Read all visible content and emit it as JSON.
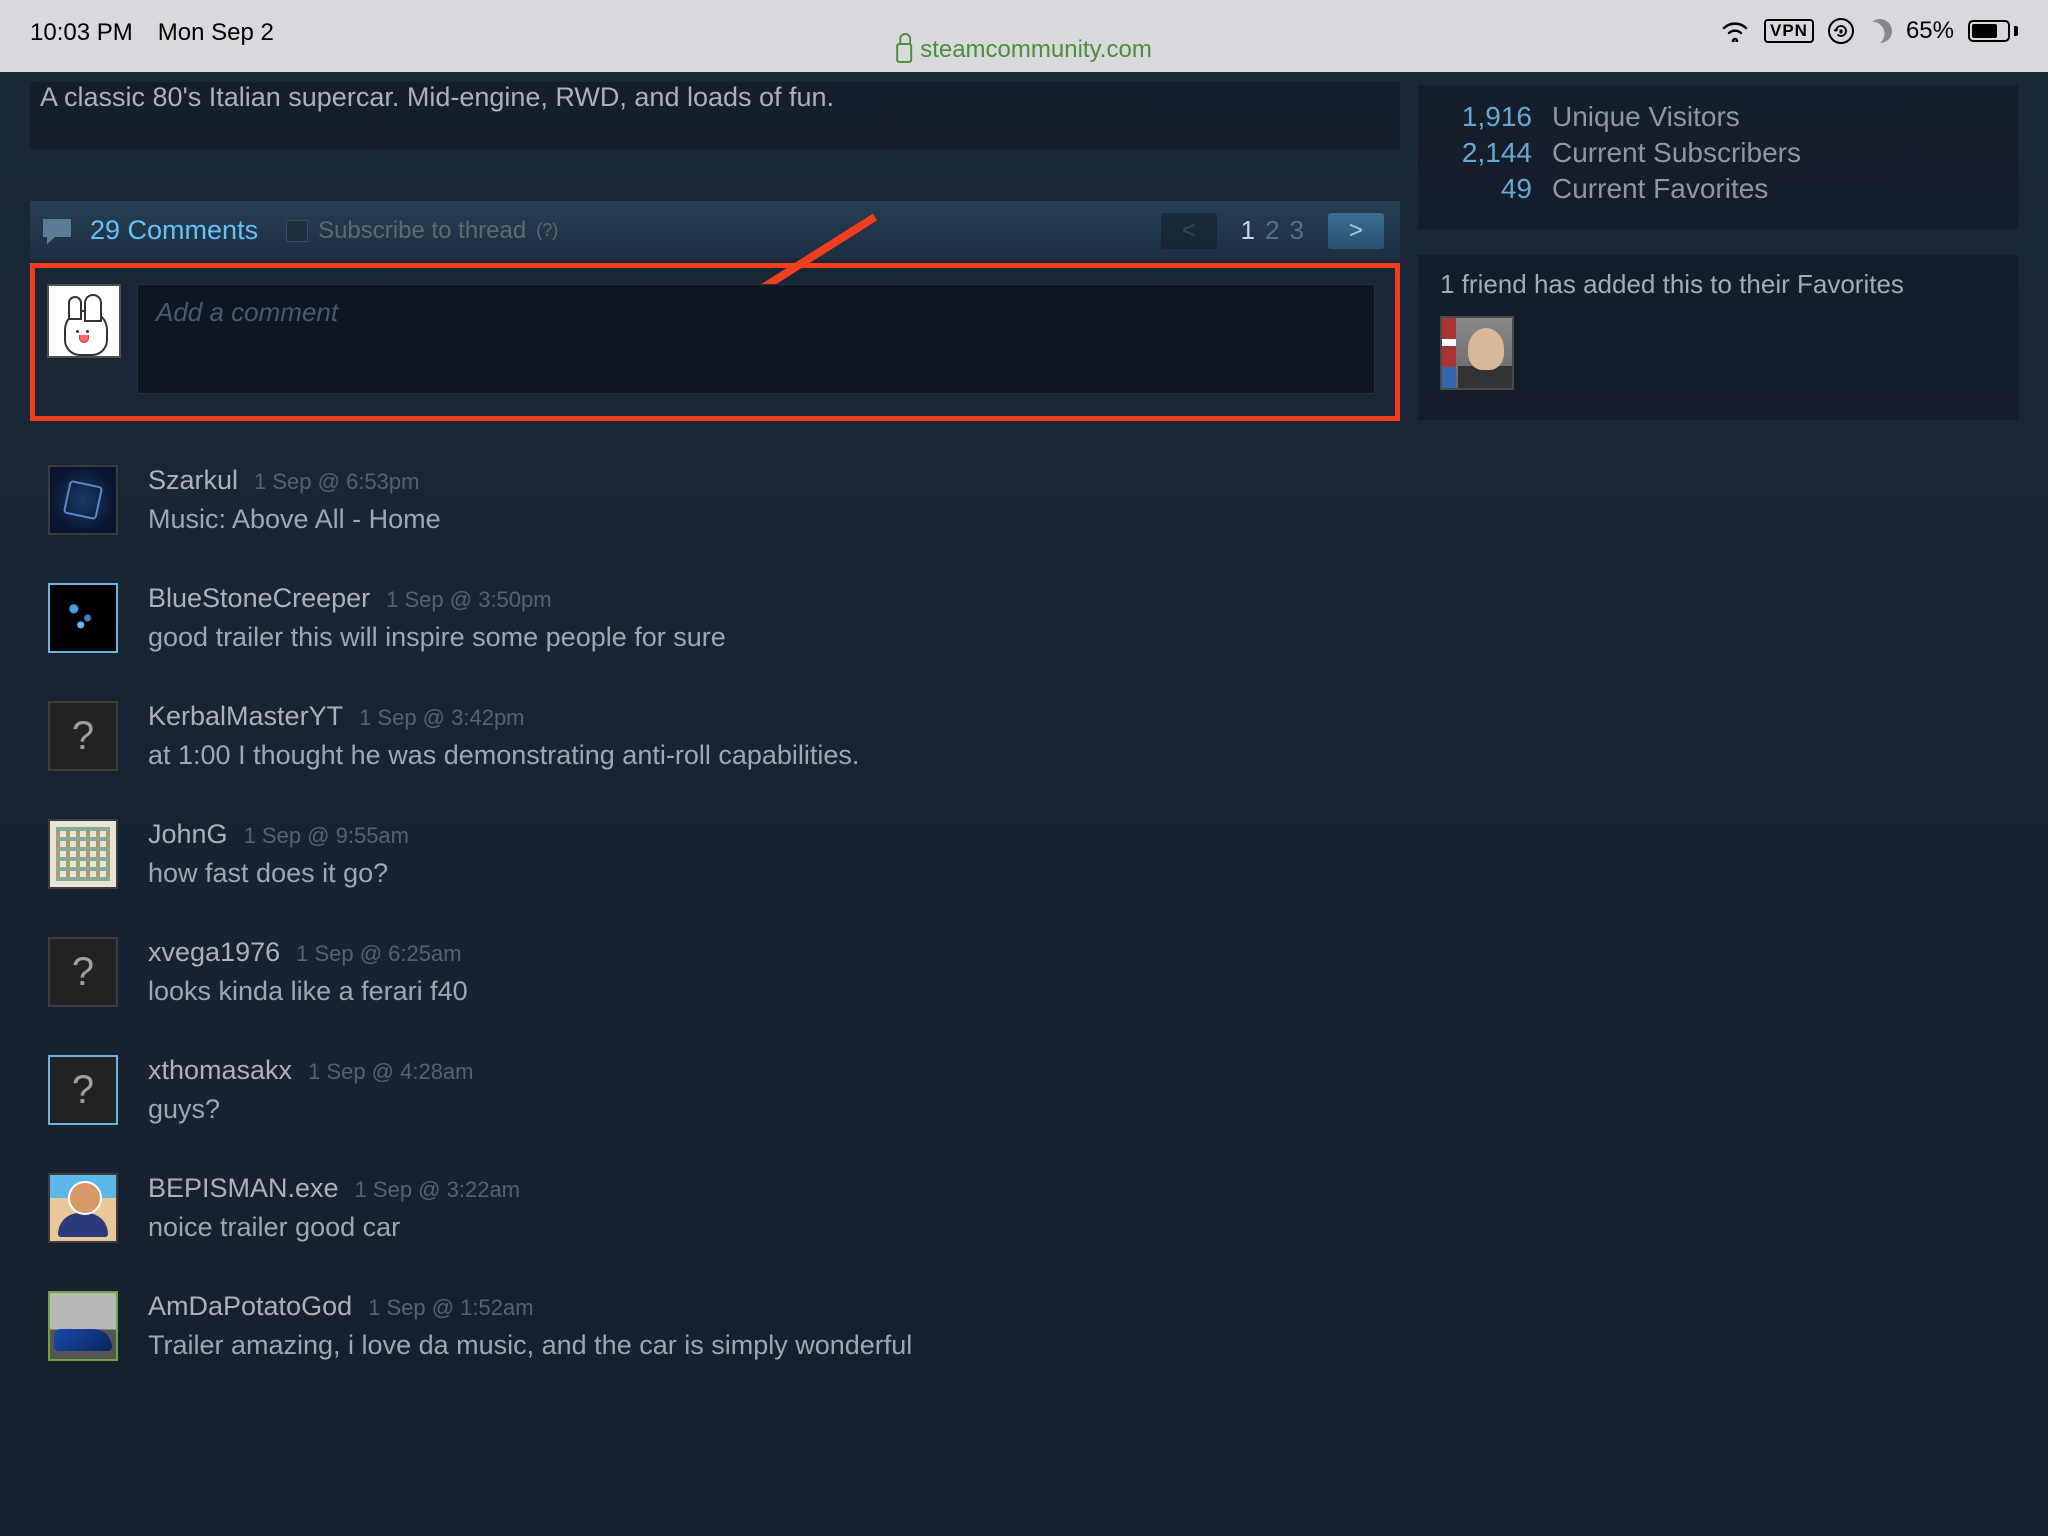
{
  "statusbar": {
    "time": "10:03 PM",
    "date": "Mon Sep 2",
    "vpn": "VPN",
    "battery_pct": "65%",
    "url": "steamcommunity.com"
  },
  "description": "A classic 80's Italian supercar. Mid-engine, RWD, and loads of fun.",
  "comments_header": {
    "count_label": "29 Comments",
    "subscribe_label": "Subscribe to thread",
    "help_marker": "(?)",
    "prev": "<",
    "next": ">",
    "pages": [
      "1",
      "2",
      "3"
    ],
    "current_page": "1"
  },
  "compose": {
    "placeholder": "Add a comment"
  },
  "comments": [
    {
      "author": "Szarkul",
      "time": "1 Sep @ 6:53pm",
      "text": "Music: Above All - Home",
      "avatar": "szarkul",
      "border": ""
    },
    {
      "author": "BlueStoneCreeper",
      "time": "1 Sep @ 3:50pm",
      "text": "good trailer this will inspire some people for sure",
      "avatar": "blue",
      "border": "online"
    },
    {
      "author": "KerbalMasterYT",
      "time": "1 Sep @ 3:42pm",
      "text": "at 1:00 I thought he was demonstrating anti-roll capabilities.",
      "avatar": "q",
      "border": ""
    },
    {
      "author": "JohnG",
      "time": "1 Sep @ 9:55am",
      "text": "how fast does it go?",
      "avatar": "john",
      "border": ""
    },
    {
      "author": "xvega1976",
      "time": "1 Sep @ 6:25am",
      "text": "looks kinda like a ferari f40",
      "avatar": "q",
      "border": ""
    },
    {
      "author": "xthomasakx",
      "time": "1 Sep @ 4:28am",
      "text": "guys?",
      "avatar": "q",
      "border": "online"
    },
    {
      "author": "BEPISMAN.exe",
      "time": "1 Sep @ 3:22am",
      "text": "noice trailer good car",
      "avatar": "bepis",
      "border": ""
    },
    {
      "author": "AmDaPotatoGod",
      "time": "1 Sep @ 1:52am",
      "text": "Trailer amazing, i love da music, and the car is simply wonderful",
      "avatar": "car",
      "border": "green"
    }
  ],
  "sidebar": {
    "stats": [
      {
        "num": "1,916",
        "label": "Unique Visitors"
      },
      {
        "num": "2,144",
        "label": "Current Subscribers"
      },
      {
        "num": "49",
        "label": "Current Favorites"
      }
    ],
    "fav_text": "1 friend has added this to their Favorites"
  }
}
